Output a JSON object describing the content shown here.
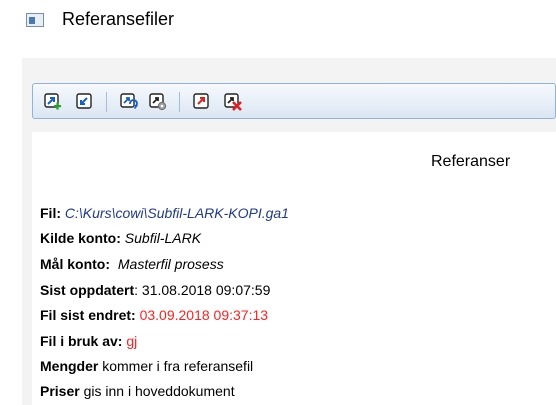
{
  "window": {
    "title": "Referansefiler",
    "icon": "window-icon"
  },
  "toolbar": {
    "buttons": [
      {
        "name": "add-reference-icon",
        "color": "#2a9d2a"
      },
      {
        "name": "import-icon",
        "color": "#1560c8"
      },
      {
        "name": "refresh-icon",
        "color": "#1560c8"
      },
      {
        "name": "settings-icon",
        "color": "#8a8a8a"
      },
      {
        "name": "export-icon",
        "color": "#e02020"
      },
      {
        "name": "delete-reference-icon",
        "color": "#e02020"
      }
    ]
  },
  "content": {
    "heading": "Referanser",
    "fil_label": "Fil:",
    "fil_value": "C:\\Kurs\\cowi\\Subfil-LARK-KOPI.ga1",
    "kilde_label": "Kilde konto:",
    "kilde_value": "Subfil-LARK",
    "maal_label": "Mål konto:",
    "maal_value": "Masterfil prosess",
    "sist_label": "Sist oppdatert",
    "sist_value": ": 31.08.2018 09:07:59",
    "endret_label": "Fil sist endret:",
    "endret_value": "03.09.2018 09:37:13",
    "bruk_label": "Fil i bruk av:",
    "bruk_value": "gj",
    "mengder_label": "Mengder",
    "mengder_value": "kommer i fra referansefil",
    "priser_label": "Priser",
    "priser_value": "gis inn i hoveddokument"
  },
  "colors": {
    "accent_blue": "#1560c8",
    "value_blue": "#1f3a8a",
    "red": "#ff2020",
    "toolbar_border": "#8fb3d9"
  }
}
